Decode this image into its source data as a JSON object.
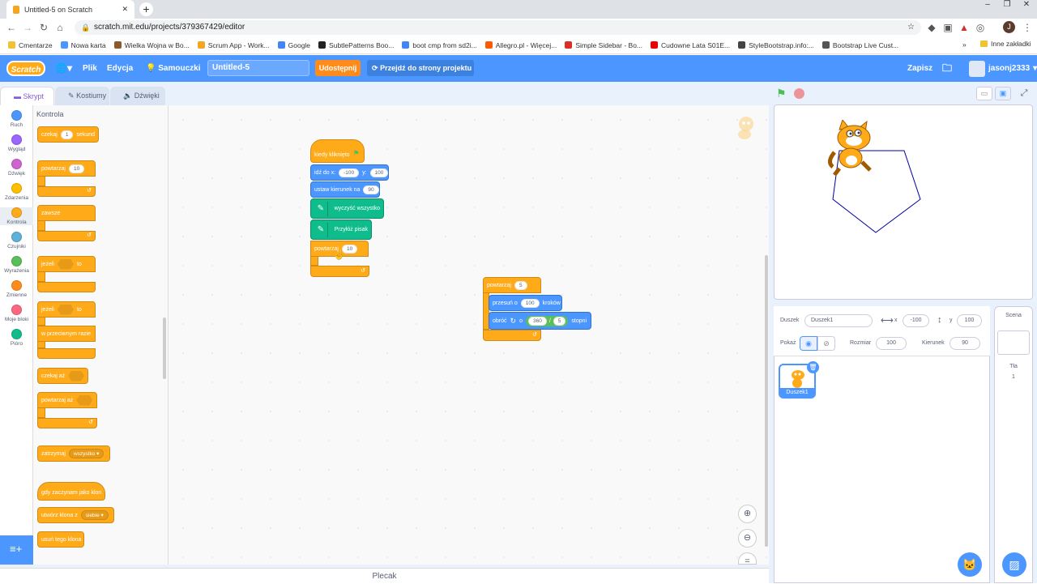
{
  "browser": {
    "tab_title": "Untitled-5 on Scratch",
    "url": "scratch.mit.edu/projects/379367429/editor",
    "profile_initial": "J",
    "bookmarks": [
      "Cmentarze",
      "Nowa karta",
      "Wielka Wojna w Bo...",
      "Scrum App - Work...",
      "Google",
      "SubtlePatterns Boo...",
      "boot cmp from sd2i...",
      "Allegro.pl - Więcej...",
      "Simple Sidebar - Bo...",
      "Cudowne Lata S01E...",
      "StyleBootstrap.info:...",
      "Bootstrap Live Cust..."
    ],
    "other_bookmarks": "Inne zakładki"
  },
  "menu": {
    "logo": "Scratch",
    "file": "Plik",
    "edit": "Edycja",
    "tutorials": "Samouczki",
    "project_title": "Untitled-5",
    "share": "Udostępnij",
    "see_project": "Przejdź do strony projektu",
    "save": "Zapisz",
    "username": "jasonj2333"
  },
  "tabs": {
    "code": "Skrypt",
    "costumes": "Kostiumy",
    "sounds": "Dźwięki"
  },
  "categories": [
    {
      "label": "Ruch",
      "color": "#4c97ff"
    },
    {
      "label": "Wygląd",
      "color": "#9966ff"
    },
    {
      "label": "Dźwięk",
      "color": "#cf63cf"
    },
    {
      "label": "Zdarzenia",
      "color": "#ffbf00"
    },
    {
      "label": "Kontrola",
      "color": "#ffab19"
    },
    {
      "label": "Czujniki",
      "color": "#5cb1d6"
    },
    {
      "label": "Wyrażenia",
      "color": "#59c059"
    },
    {
      "label": "Zmienne",
      "color": "#ff8c1a"
    },
    {
      "label": "Moje bloki",
      "color": "#ff6680"
    },
    {
      "label": "Pióro",
      "color": "#0fbd8c"
    }
  ],
  "palette": {
    "heading": "Kontrola",
    "wait": "czekaj",
    "wait_val": "1",
    "wait_unit": "sekund",
    "repeat": "powtarzaj",
    "repeat_val": "10",
    "forever": "zawsze",
    "if": "jeżeli",
    "then": "to",
    "if2": "jeżeli",
    "then2": "to",
    "else": "w przeciwnym razie",
    "wait_until": "czekaj aż",
    "repeat_until": "powtarzaj aż",
    "stop": "zatrzymaj",
    "stop_val": "wszystko",
    "clone_start": "gdy zaczynam jako klon",
    "create_clone": "utwórz klona z",
    "create_clone_val": "siebie",
    "delete_clone": "usuń tego klona"
  },
  "script1": {
    "hat": "kiedy kliknięto",
    "goto": "idź do x:",
    "goto_x": "-100",
    "goto_y_label": "y:",
    "goto_y": "100",
    "direction": "ustaw kierunek na",
    "direction_val": "90",
    "clear": "wyczyść wszystko",
    "pendown": "Przyłóż pisak",
    "repeat": "powtarzaj",
    "repeat_val": "10"
  },
  "script2": {
    "repeat": "powtarzaj",
    "repeat_val": "5",
    "move": "przesuń o",
    "move_val": "100",
    "move_unit": "kroków",
    "turn": "obróć",
    "turn_o": "o",
    "turn_a": "360",
    "turn_div": "/",
    "turn_b": "5",
    "turn_unit": "stopni"
  },
  "backpack": "Plecak",
  "sprite_info": {
    "sprite_label": "Duszek",
    "sprite_name": "Duszek1",
    "x_label": "x",
    "x": "-100",
    "y_label": "y",
    "y": "100",
    "show_label": "Pokaż",
    "size_label": "Rozmiar",
    "size": "100",
    "direction_label": "Kierunek",
    "direction": "90"
  },
  "sprite_tile": "Duszek1",
  "scene": {
    "title": "Scena",
    "backdrops_label": "Tła",
    "backdrops_count": "1"
  },
  "colors": {
    "accent": "#4c97ff",
    "control": "#ffab19",
    "motion": "#4c97ff",
    "pen": "#0fbd8c"
  }
}
